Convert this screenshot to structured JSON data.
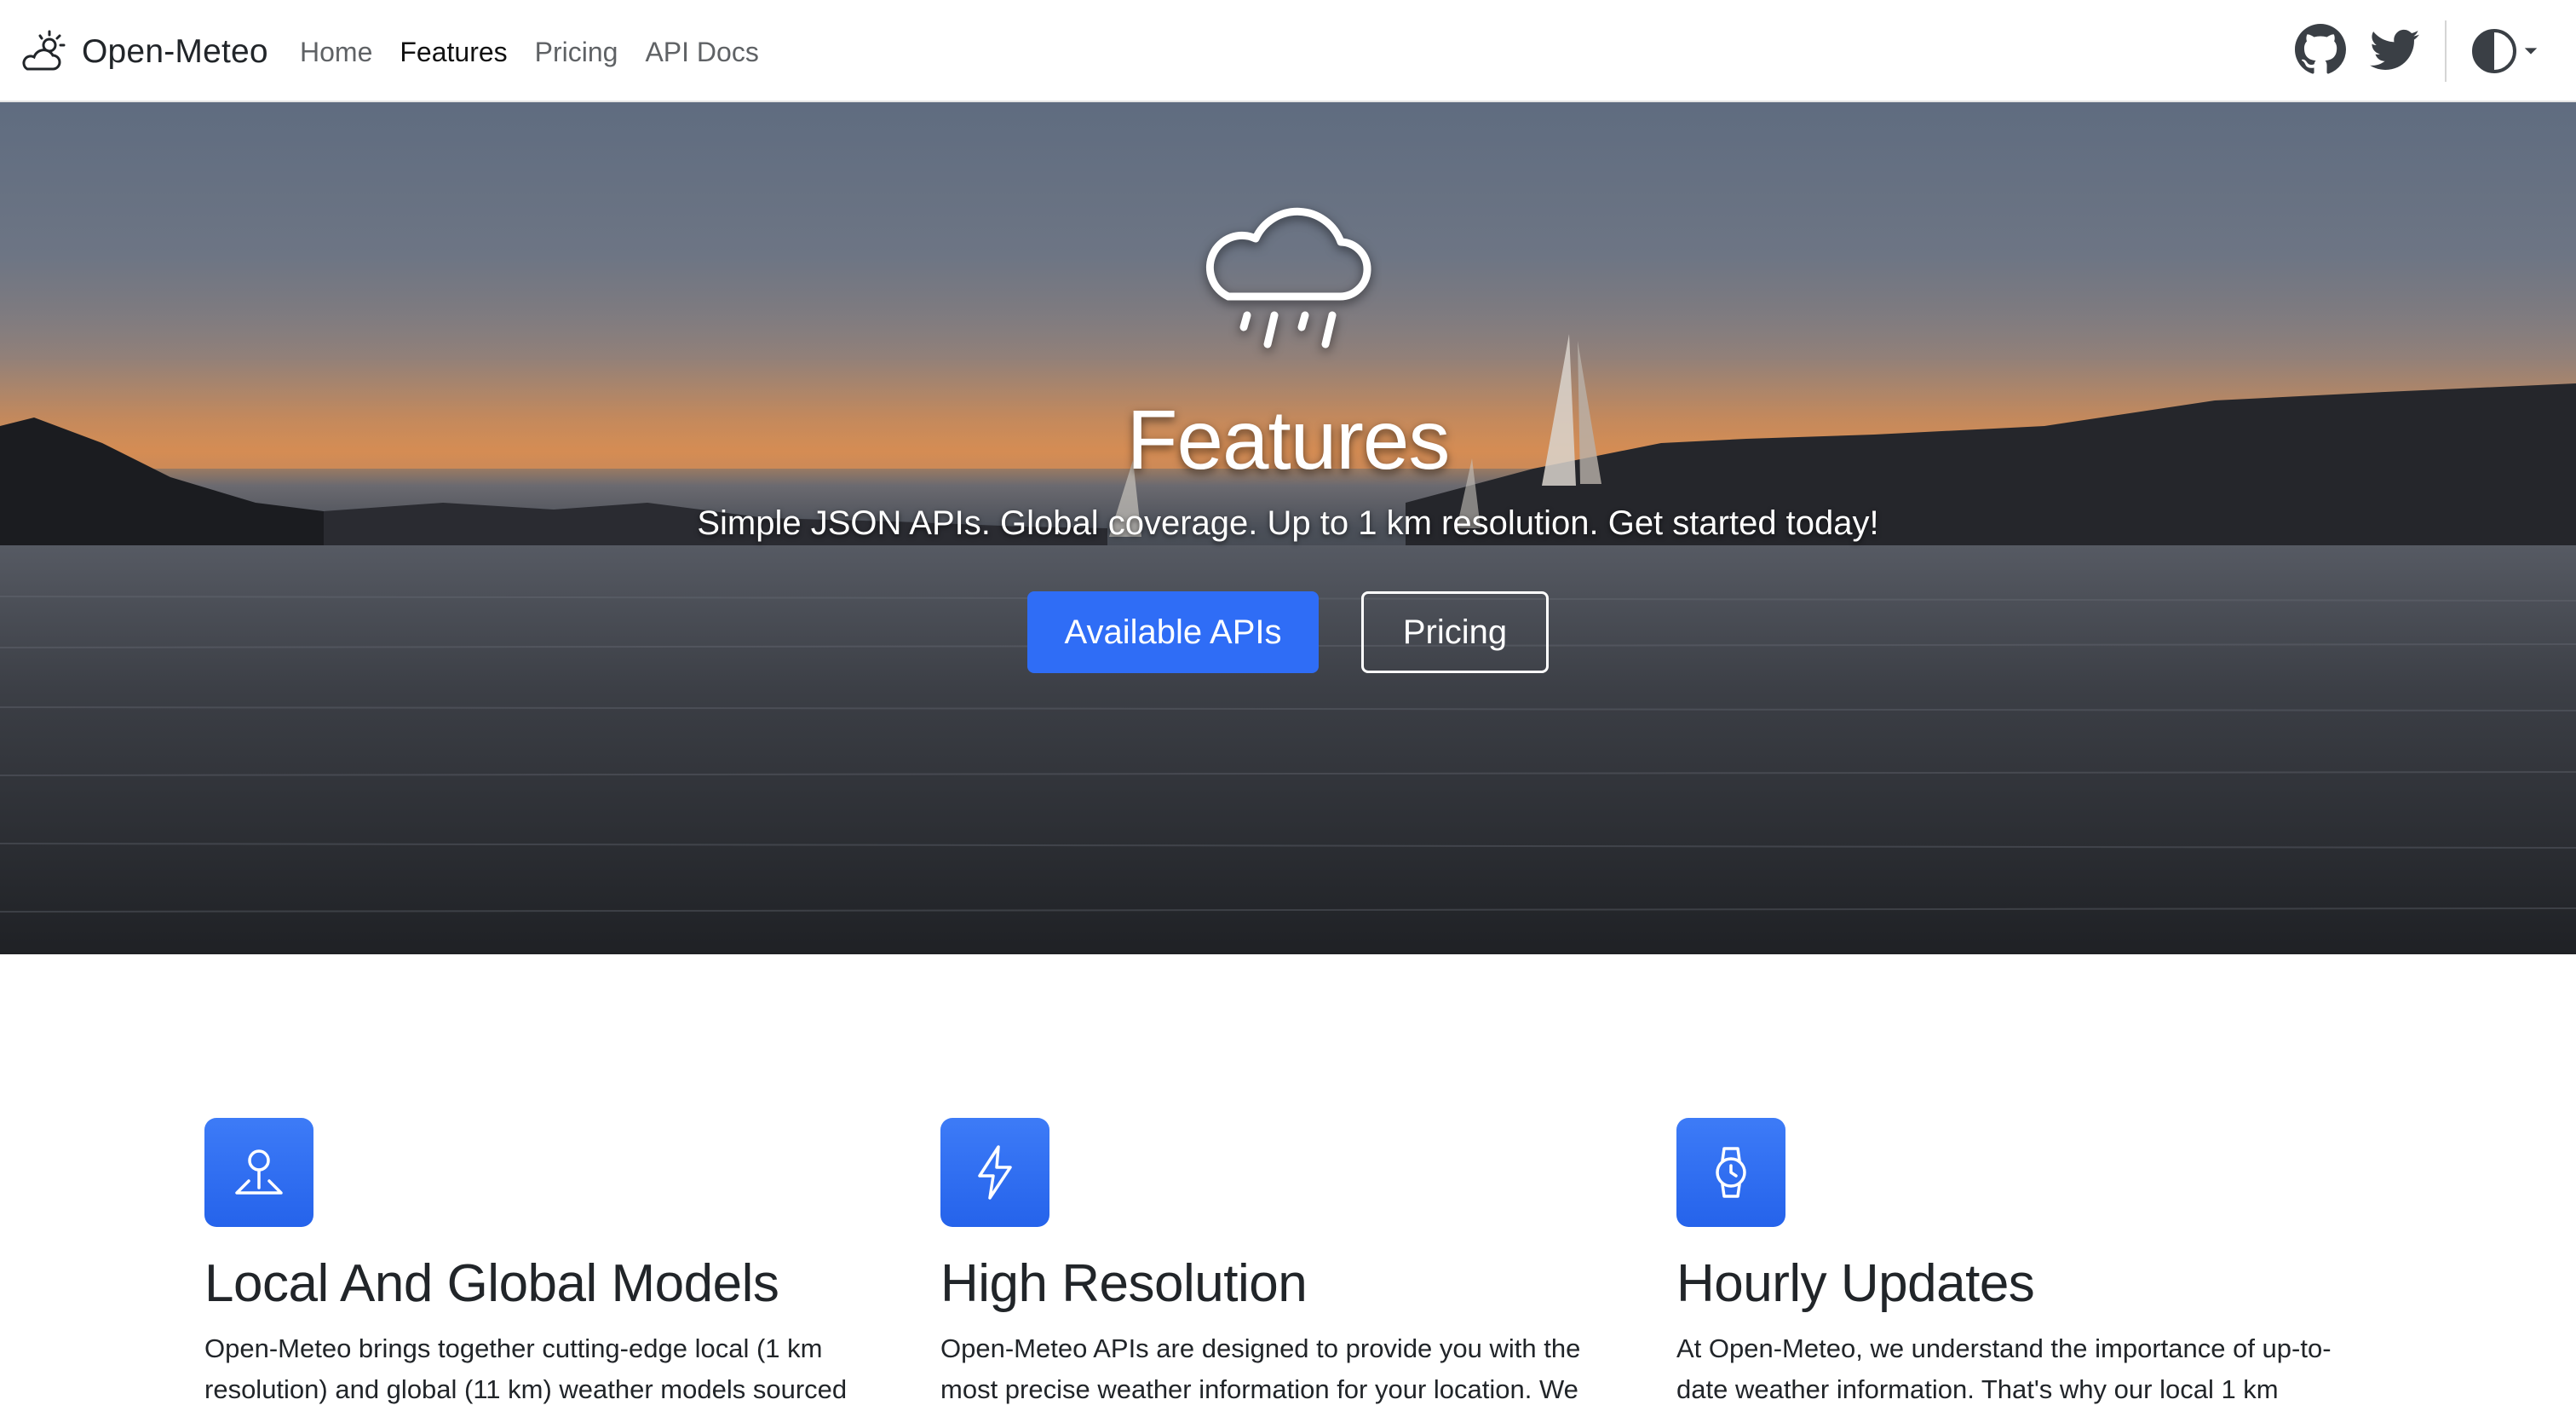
{
  "navbar": {
    "brand": "Open-Meteo",
    "links": [
      {
        "label": "Home",
        "active": false
      },
      {
        "label": "Features",
        "active": true
      },
      {
        "label": "Pricing",
        "active": false
      },
      {
        "label": "API Docs",
        "active": false
      }
    ],
    "icons": [
      "github-icon",
      "twitter-icon",
      "theme-toggle-icon"
    ]
  },
  "hero": {
    "icon": "cloud-rain-icon",
    "title": "Features",
    "subtitle": "Simple JSON APIs. Global coverage. Up to 1 km resolution. Get started today!",
    "primary_button": "Available APIs",
    "secondary_button": "Pricing"
  },
  "features": [
    {
      "icon": "map-pin-icon",
      "title": "Local And Global Models",
      "text": "Open-Meteo brings together cutting-edge local (1 km resolution) and global (11 km) weather models sourced"
    },
    {
      "icon": "lightning-icon",
      "title": "High Resolution",
      "text": "Open-Meteo APIs are designed to provide you with the most precise weather information for your location. We"
    },
    {
      "icon": "watch-icon",
      "title": "Hourly Updates",
      "text": "At Open-Meteo, we understand the importance of up-to-date weather information. That's why our local 1 km"
    }
  ],
  "colors": {
    "primary": "#2f6df6",
    "navbar_bg": "#ffffff",
    "text": "#212529"
  }
}
